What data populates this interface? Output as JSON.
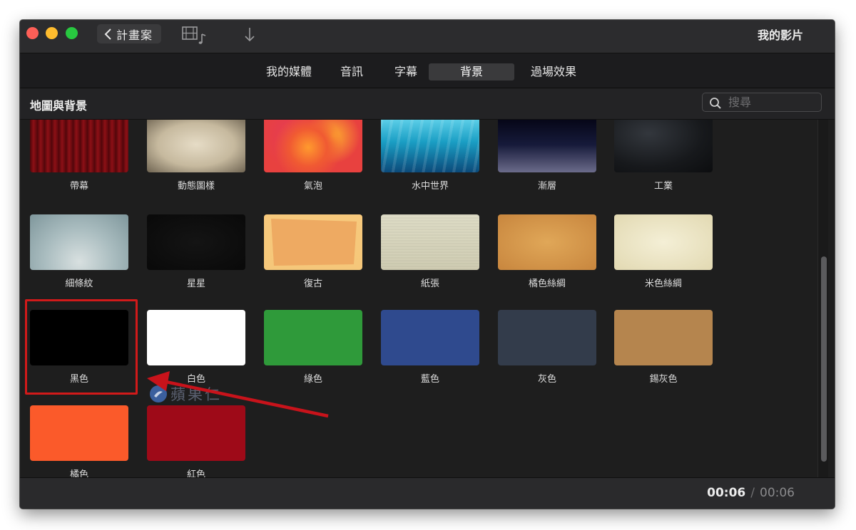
{
  "window": {
    "back_label": "計畫案",
    "title": "我的影片"
  },
  "tabs": [
    {
      "label": "我的媒體"
    },
    {
      "label": "音訊"
    },
    {
      "label": "字幕"
    },
    {
      "label": "背景",
      "active": true
    },
    {
      "label": "過場效果"
    }
  ],
  "browser": {
    "section_title": "地圖與背景",
    "search_placeholder": "搜尋"
  },
  "backgrounds": [
    {
      "label": "帶幕",
      "color": "#7a0e12",
      "style": "curtain"
    },
    {
      "label": "動態圖樣",
      "color": "#c9bda3",
      "style": "parchment"
    },
    {
      "label": "氣泡",
      "color": "#e8413f",
      "style": "bubbles"
    },
    {
      "label": "水中世界",
      "color": "#1aa2c4",
      "style": "underwater"
    },
    {
      "label": "漸層",
      "color": "#2a2a44",
      "style": "gradient"
    },
    {
      "label": "工業",
      "color": "#17191c",
      "style": "industrial"
    },
    {
      "label": "細條紋",
      "color": "#9fb2b6",
      "style": "pinstripe"
    },
    {
      "label": "星星",
      "color": "#0e0e0e",
      "style": "stars"
    },
    {
      "label": "復古",
      "color": "#f0b86a",
      "style": "retro"
    },
    {
      "label": "紙張",
      "color": "#d8d7bf",
      "style": "paper"
    },
    {
      "label": "橘色絲綢",
      "color": "#d99a4c",
      "style": "silk"
    },
    {
      "label": "米色絲綢",
      "color": "#ece6c8",
      "style": "silk-cream"
    },
    {
      "label": "黑色",
      "color": "#000000",
      "style": "solid"
    },
    {
      "label": "白色",
      "color": "#ffffff",
      "style": "solid"
    },
    {
      "label": "綠色",
      "color": "#2f9a3a",
      "style": "solid"
    },
    {
      "label": "藍色",
      "color": "#2f4a8e",
      "style": "solid"
    },
    {
      "label": "灰色",
      "color": "#333c4b",
      "style": "solid"
    },
    {
      "label": "錫灰色",
      "color": "#b5854e",
      "style": "solid"
    },
    {
      "label": "橘色",
      "color": "#fb5a2a",
      "style": "solid"
    },
    {
      "label": "紅色",
      "color": "#9e0a18",
      "style": "solid"
    }
  ],
  "watermark": "蘋果仁",
  "timecode": {
    "current": "00:06",
    "separator": "/",
    "total": "00:06"
  }
}
